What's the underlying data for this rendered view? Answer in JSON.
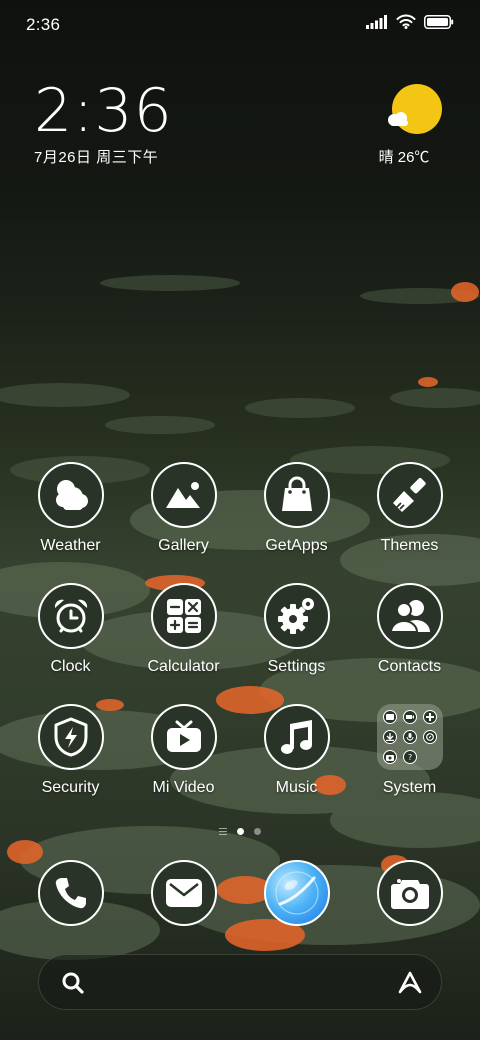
{
  "status_bar": {
    "time": "2:36",
    "icons": [
      "signal-icon",
      "wifi-icon",
      "battery-icon"
    ]
  },
  "clock_widget": {
    "time": "2:36",
    "date": "7月26日 周三下午"
  },
  "weather_widget": {
    "condition_icon": "sun-cloud-icon",
    "text": "晴 26℃"
  },
  "apps": [
    {
      "label": "Weather",
      "icon": "weather-icon"
    },
    {
      "label": "Gallery",
      "icon": "gallery-icon"
    },
    {
      "label": "GetApps",
      "icon": "getapps-icon"
    },
    {
      "label": "Themes",
      "icon": "themes-icon"
    },
    {
      "label": "Clock",
      "icon": "clock-icon"
    },
    {
      "label": "Calculator",
      "icon": "calculator-icon"
    },
    {
      "label": "Settings",
      "icon": "settings-icon"
    },
    {
      "label": "Contacts",
      "icon": "contacts-icon"
    },
    {
      "label": "Security",
      "icon": "security-icon"
    },
    {
      "label": "Mi Video",
      "icon": "mi-video-icon"
    },
    {
      "label": "Music",
      "icon": "music-icon"
    },
    {
      "label": "System",
      "icon": "folder-icon"
    }
  ],
  "page_indicator": {
    "pages": 2,
    "current": 1
  },
  "dock": [
    {
      "icon": "phone-icon"
    },
    {
      "icon": "messages-icon"
    },
    {
      "icon": "browser-icon"
    },
    {
      "icon": "camera-icon"
    }
  ],
  "search_bar": {
    "left_icon": "search-icon",
    "right_icon": "assistant-icon"
  },
  "colors": {
    "icon_fill": "#2a3327",
    "accent_sun": "#f3c514",
    "lotus": "#e8662a"
  }
}
